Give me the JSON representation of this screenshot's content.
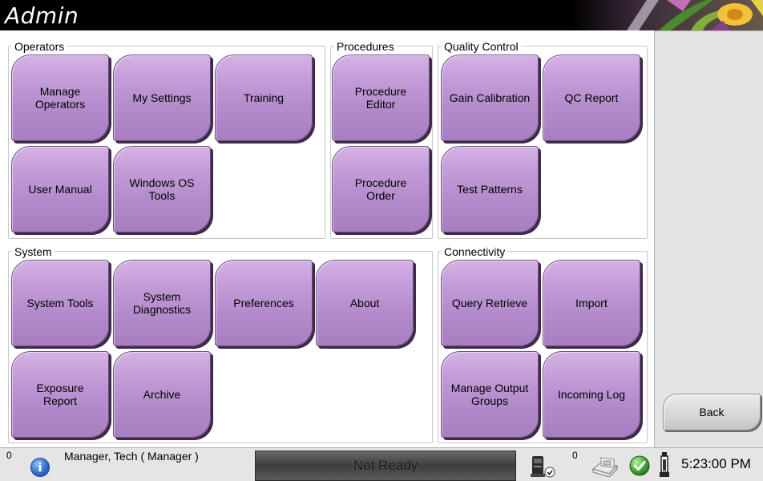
{
  "app": {
    "title": "Admin"
  },
  "groups": {
    "operators": {
      "label": "Operators",
      "buttons": [
        "Manage\nOperators",
        "My Settings",
        "Training",
        "User Manual",
        "Windows OS\nTools"
      ]
    },
    "procedures": {
      "label": "Procedures",
      "buttons": [
        "Procedure\nEditor",
        "Procedure\nOrder"
      ]
    },
    "quality_control": {
      "label": "Quality Control",
      "buttons": [
        "Gain Calibration",
        "QC Report",
        "Test Patterns"
      ]
    },
    "system": {
      "label": "System",
      "buttons": [
        "System Tools",
        "System\nDiagnostics",
        "Preferences",
        "About",
        "Exposure\nReport",
        "Archive"
      ]
    },
    "connectivity": {
      "label": "Connectivity",
      "buttons": [
        "Query Retrieve",
        "Import",
        "Manage Output\nGroups",
        "Incoming Log"
      ]
    }
  },
  "side": {
    "back_label": "Back"
  },
  "status": {
    "alert_count": "0",
    "user": "Manager, Tech ( Manager )",
    "state": "Not Ready",
    "queue_count": "0",
    "time": "5:23:00 PM"
  },
  "colors": {
    "button_purple": "#b48ccc",
    "title_bar": "#000000",
    "status_ok": "#4caf50"
  }
}
